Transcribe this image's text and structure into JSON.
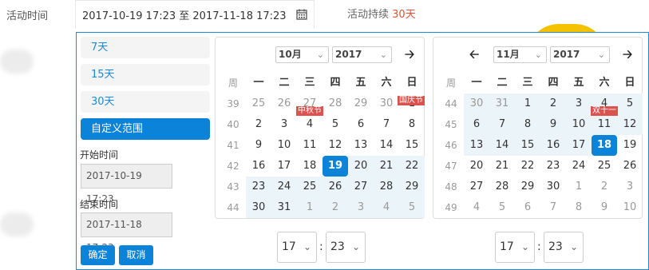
{
  "form": {
    "label": "活动时间",
    "range_value": "2017-10-19 17:23 至 2017-11-18 17:23",
    "duration_label": "活动持续",
    "duration_value": "30天"
  },
  "ranges": [
    "7天",
    "15天",
    "30天",
    "自定义范围"
  ],
  "start": {
    "label": "开始时间",
    "value": "2017-10-19 17:23"
  },
  "end": {
    "label": "结束时间",
    "value": "2017-11-18 17:23"
  },
  "buttons": {
    "ok": "确定",
    "cancel": "取消"
  },
  "weekday_headers": [
    "周",
    "一",
    "二",
    "三",
    "四",
    "五",
    "六",
    "日"
  ],
  "left_cal": {
    "month": "10月",
    "year": "2017",
    "weeks": [
      {
        "wk": "39",
        "days": [
          "25",
          "26",
          "27",
          "28",
          "29",
          "30",
          "1"
        ]
      },
      {
        "wk": "40",
        "days": [
          "2",
          "3",
          "4",
          "5",
          "6",
          "7",
          "8"
        ]
      },
      {
        "wk": "41",
        "days": [
          "9",
          "10",
          "11",
          "12",
          "13",
          "14",
          "15"
        ]
      },
      {
        "wk": "42",
        "days": [
          "16",
          "17",
          "18",
          "19",
          "20",
          "21",
          "22"
        ]
      },
      {
        "wk": "43",
        "days": [
          "23",
          "24",
          "25",
          "26",
          "27",
          "28",
          "29"
        ]
      },
      {
        "wk": "44",
        "days": [
          "30",
          "31",
          "1",
          "2",
          "3",
          "4",
          "5"
        ]
      }
    ],
    "festivals": [
      {
        "text": "国庆节",
        "row": 0,
        "col": 6
      },
      {
        "text": "中秋节",
        "row": 0,
        "col": 2
      }
    ],
    "hour": "17",
    "minute": "23"
  },
  "right_cal": {
    "month": "11月",
    "year": "2017",
    "weeks": [
      {
        "wk": "44",
        "days": [
          "30",
          "31",
          "1",
          "2",
          "3",
          "4",
          "5"
        ]
      },
      {
        "wk": "45",
        "days": [
          "6",
          "7",
          "8",
          "9",
          "10",
          "11",
          "12"
        ]
      },
      {
        "wk": "46",
        "days": [
          "13",
          "14",
          "15",
          "16",
          "17",
          "18",
          "19"
        ]
      },
      {
        "wk": "47",
        "days": [
          "20",
          "21",
          "22",
          "23",
          "24",
          "25",
          "26"
        ]
      },
      {
        "wk": "48",
        "days": [
          "27",
          "28",
          "29",
          "30",
          "1",
          "2",
          "3"
        ]
      },
      {
        "wk": "49",
        "days": [
          "4",
          "5",
          "6",
          "7",
          "8",
          "9",
          "10"
        ]
      }
    ],
    "festivals": [
      {
        "text": "双十一",
        "row": 0,
        "col": 5
      }
    ],
    "hour": "17",
    "minute": "23"
  },
  "colors": {
    "accent": "#0b83d9",
    "range_bg": "#ebf4f8",
    "festival": "#d9534f",
    "duration": "#e4513b"
  },
  "icons": {
    "calendar": "calendar-icon",
    "prev": "chevron-left-icon",
    "next": "chevron-right-icon"
  }
}
